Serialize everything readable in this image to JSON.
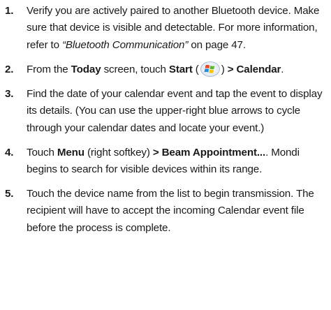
{
  "steps": [
    {
      "number": "1.",
      "t1": "Verify you are actively paired to another Bluetooth device. Make sure that device is visible and detectable. For more information, refer to ",
      "ref": "“Bluetooth Communication”",
      "t2": " on page 47."
    },
    {
      "number": "2.",
      "t1": "From the ",
      "today": "Today",
      "t2": " screen, touch ",
      "start": "Start",
      "paren_open": " (",
      "start_icon": "windows-start-logo",
      "paren_close": ") ",
      "arrow_calendar": "> Calendar",
      "t3": "."
    },
    {
      "number": "3.",
      "t1": "Find the date of your calendar event and tap the event to display its details. (You can use the upper-right blue arrows to cycle through your calendar dates and locate your event.)"
    },
    {
      "number": "4.",
      "t1": "Touch ",
      "menu": "Menu",
      "t2": " (right softkey) ",
      "beam": "> Beam Appointment...",
      "t3": ". Mondi begins to search for visible devices within its range."
    },
    {
      "number": "5.",
      "t1": "Touch the device name from the list to begin transmission. The recipient will have to accept the incoming Calendar event file before the process is complete."
    }
  ]
}
